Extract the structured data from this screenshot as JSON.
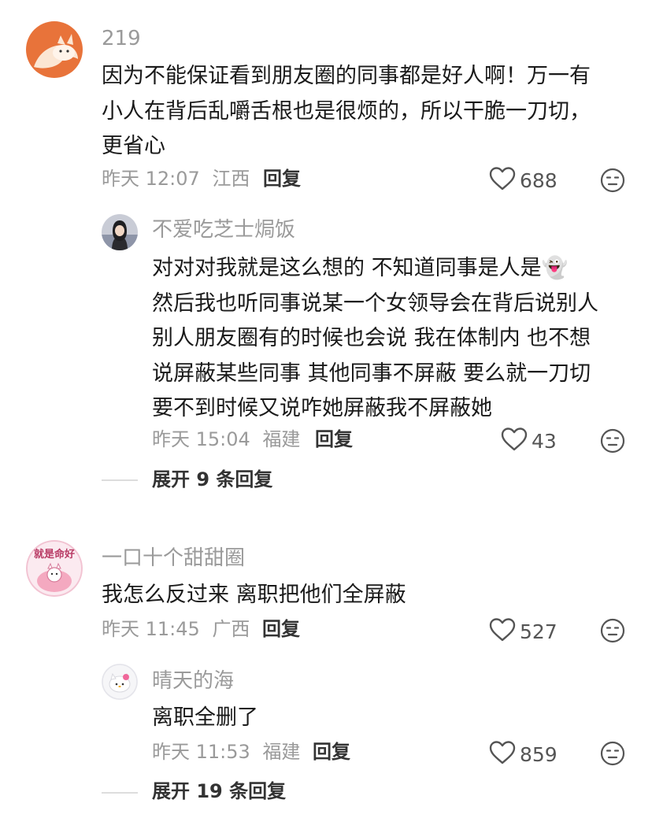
{
  "comments": [
    {
      "username": "219",
      "lines": [
        "因为不能保证看到朋友圈的同事都是好人啊！万一有",
        "小人在背后乱嚼舌根也是很烦的，所以干脆一刀切，",
        "更省心"
      ],
      "time": "昨天 12:07",
      "location": "江西",
      "reply_label": "回复",
      "likes": "688",
      "replies": [
        {
          "username": "不爱吃芝士焗饭",
          "lines": [
            "对对对我就是这么想的  不知道同事是人是👻",
            "然后我也听同事说某一个女领导会在背后说别人",
            "别人朋友圈有的时候也会说 我在体制内 也不想",
            "说屏蔽某些同事  其他同事不屏蔽  要么就一刀切",
            "要不到时候又说咋她屏蔽我不屏蔽她"
          ],
          "time": "昨天 15:04",
          "location": "福建",
          "reply_label": "回复",
          "likes": "43"
        }
      ],
      "expand_label": "展开 9 条回复"
    },
    {
      "username": "一口十个甜甜圈",
      "lines": [
        "我怎么反过来 离职把他们全屏蔽"
      ],
      "time": "昨天 11:45",
      "location": "广西",
      "reply_label": "回复",
      "likes": "527",
      "avatar_text": "就是命好",
      "replies": [
        {
          "username": "晴天的海",
          "lines": [
            "离职全删了"
          ],
          "time": "昨天 11:53",
          "location": "福建",
          "reply_label": "回复",
          "likes": "859"
        }
      ],
      "expand_label": "展开 19 条回复"
    }
  ],
  "icons": {
    "like": "heart-outline-icon",
    "dislike": "meh-face-icon"
  },
  "colors": {
    "text": "#1a1a1a",
    "muted": "#9a9a9a",
    "avatar1_bg": "#e8733a"
  }
}
